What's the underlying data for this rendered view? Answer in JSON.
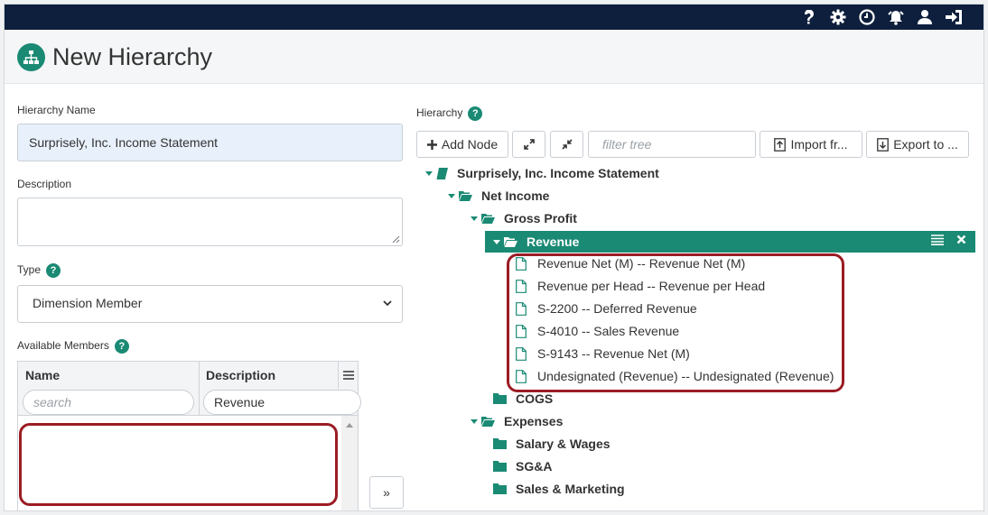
{
  "page": {
    "title": "New Hierarchy"
  },
  "topbar": {
    "icons": [
      "help-icon",
      "gear-icon",
      "clock-icon",
      "alarm-icon",
      "user-icon",
      "sign-out-icon"
    ]
  },
  "form": {
    "hierarchy_name_label": "Hierarchy Name",
    "hierarchy_name_value": "Surprisely, Inc. Income Statement",
    "description_label": "Description",
    "description_value": "",
    "type_label": "Type",
    "type_value": "Dimension Member",
    "available_members_label": "Available Members"
  },
  "members_grid": {
    "columns": [
      "Name",
      "Description"
    ],
    "name_search_placeholder": "search",
    "description_search_value": "Revenue",
    "rows": []
  },
  "move_button_label": "»",
  "hierarchy_panel": {
    "label": "Hierarchy",
    "add_node_label": "Add Node",
    "filter_placeholder": "filter tree",
    "import_label": "Import fr...",
    "export_label": "Export to ...",
    "tree": {
      "root": "Surprisely, Inc. Income Statement",
      "net_income": "Net Income",
      "gross_profit": "Gross Profit",
      "revenue": "Revenue",
      "revenue_children": [
        "Revenue Net (M) -- Revenue Net (M)",
        "Revenue per Head -- Revenue per Head",
        "S-2200 -- Deferred Revenue",
        "S-4010 -- Sales Revenue",
        "S-9143 -- Revenue Net (M)",
        "Undesignated (Revenue) -- Undesignated (Revenue)"
      ],
      "cogs": "COGS",
      "expenses": "Expenses",
      "expense_children": [
        "Salary & Wages",
        "SG&A",
        "Sales & Marketing"
      ]
    }
  },
  "colors": {
    "accent": "#1a8a74",
    "topbar": "#0d1f3c",
    "highlight_box": "#9b1c25",
    "name_field_bg": "#e8f0fb"
  }
}
